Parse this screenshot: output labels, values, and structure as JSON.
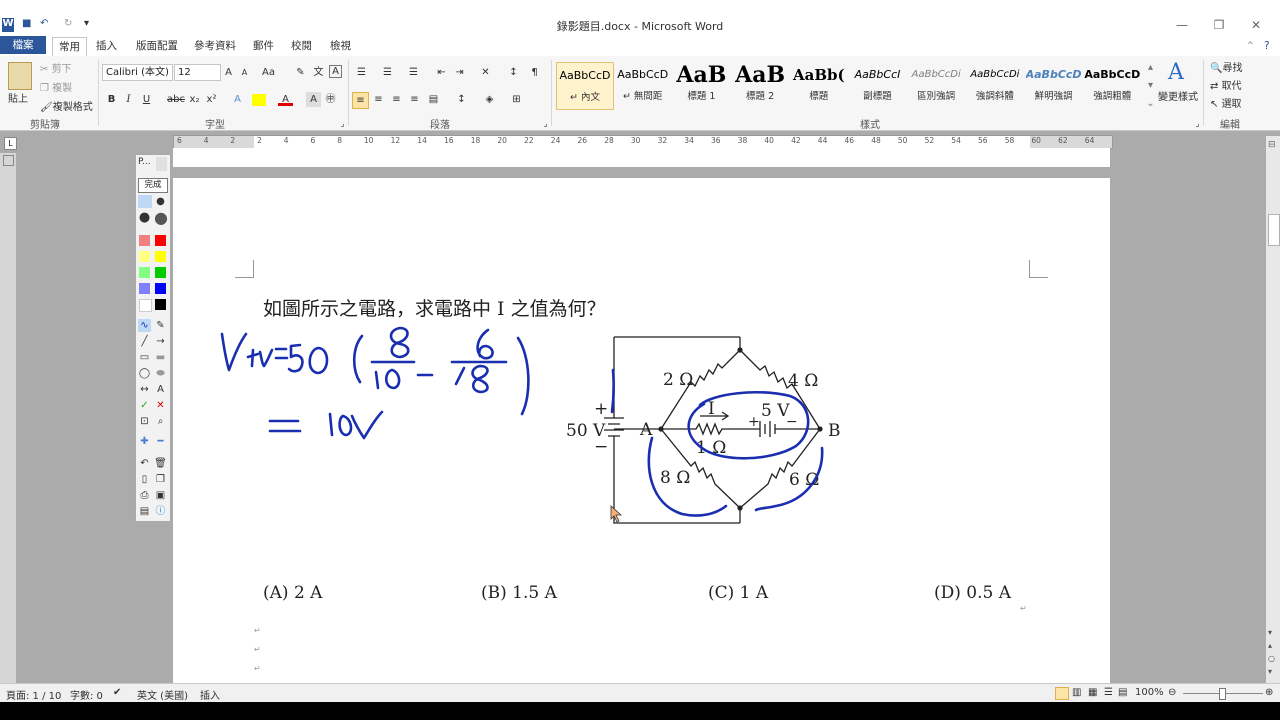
{
  "window": {
    "title": "錄影題目.docx - Microsoft Word",
    "app_icon": "W",
    "qat": {
      "save_icon": "floppy-icon",
      "undo_icon": "↶",
      "redo_icon": "↻",
      "customize_icon": "▾"
    },
    "controls": {
      "minimize": "—",
      "restore": "❐",
      "close": "✕"
    }
  },
  "tabs": [
    "檔案",
    "常用",
    "插入",
    "版面配置",
    "參考資料",
    "郵件",
    "校閱",
    "檢視"
  ],
  "active_tab": "常用",
  "ribbon": {
    "clipboard": {
      "label": "剪貼簿",
      "paste": "貼上",
      "cut": "剪下",
      "copy": "複製",
      "format_painter": "複製格式"
    },
    "font": {
      "label": "字型",
      "font_name": "Calibri (本文)",
      "font_size": "12"
    },
    "paragraph": {
      "label": "段落"
    },
    "styles": {
      "label": "樣式",
      "items": [
        {
          "sample": "AaBbCcD",
          "name": "↵ 內文"
        },
        {
          "sample": "AaBbCcD",
          "name": "↵ 無間距"
        },
        {
          "sample": "AaB",
          "name": "標題 1"
        },
        {
          "sample": "AaB",
          "name": "標題 2"
        },
        {
          "sample": "AaBb(",
          "name": "標題"
        },
        {
          "sample": "AaBbCcI",
          "name": "副標題"
        },
        {
          "sample": "AaBbCcDi",
          "name": "區別強調"
        },
        {
          "sample": "AaBbCcDi",
          "name": "強調斜體"
        },
        {
          "sample": "AaBbCcD",
          "name": "鮮明強調"
        },
        {
          "sample": "AaBbCcD",
          "name": "強調粗體"
        }
      ],
      "change_styles": "變更樣式"
    },
    "editing": {
      "label": "編輯",
      "find": "尋找",
      "replace": "取代",
      "select": "選取"
    }
  },
  "ruler_numbers": [
    "6",
    "4",
    "2",
    "2",
    "4",
    "6",
    "8",
    "10",
    "12",
    "14",
    "16",
    "18",
    "20",
    "22",
    "24",
    "26",
    "28",
    "30",
    "32",
    "34",
    "36",
    "38",
    "40",
    "42",
    "44",
    "46",
    "48",
    "50",
    "52",
    "54",
    "56",
    "58",
    "60",
    "62",
    "64"
  ],
  "ink_palette": {
    "title": "P...",
    "done_label": "完成",
    "colors": [
      "#F08080",
      "#FF0000",
      "#FFFF80",
      "#FFFF00",
      "#80FF80",
      "#00CC00",
      "#8080FF",
      "#0000FF",
      "#FFFFFF",
      "#000000"
    ],
    "ink_color": "#1A2EB0"
  },
  "document": {
    "question": "如圖所示之電路，求電路中 I 之值為何？",
    "choices": [
      "(A) 2 A",
      "(B) 1.5 A",
      "(C) 1 A",
      "(D) 0.5 A"
    ],
    "circuit": {
      "source": "50 V",
      "plus": "+",
      "minus": "−",
      "node_a": "A",
      "node_b": "B",
      "r_top_left": "2 Ω",
      "r_top_right": "4 Ω",
      "r_mid": "1 Ω",
      "battery_mid": "5 V",
      "current": "I",
      "r_bottom_left": "8 Ω",
      "r_bottom_right": "6 Ω"
    }
  },
  "status": {
    "page": "頁面: 1 / 10",
    "words": "字數: 0",
    "language": "英文 (美國)",
    "mode": "插入",
    "zoom": "100%"
  }
}
